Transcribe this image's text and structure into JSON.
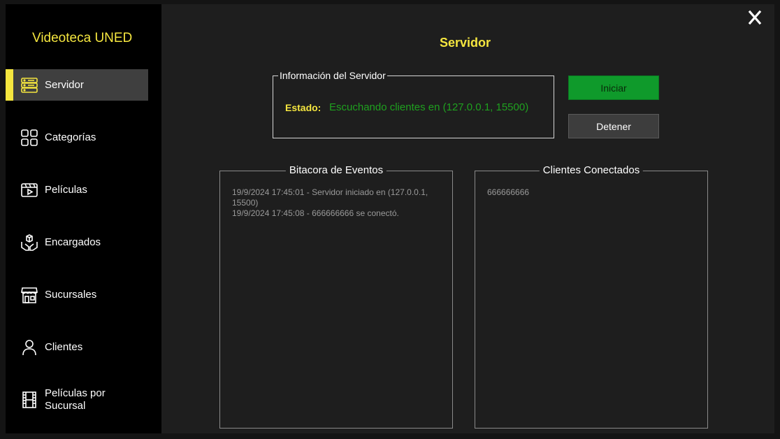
{
  "app": {
    "title": "Videoteca UNED"
  },
  "sidebar": {
    "items": [
      {
        "label": "Servidor",
        "icon": "server-icon",
        "active": true
      },
      {
        "label": "Categorías",
        "icon": "grid-icon",
        "active": false
      },
      {
        "label": "Películas",
        "icon": "video-icon",
        "active": false
      },
      {
        "label": "Encargados",
        "icon": "hands-box-icon",
        "active": false
      },
      {
        "label": "Sucursales",
        "icon": "store-icon",
        "active": false
      },
      {
        "label": "Clientes",
        "icon": "user-icon",
        "active": false
      },
      {
        "label": "Películas por Sucursal",
        "icon": "film-strip-icon",
        "active": false
      }
    ]
  },
  "window": {
    "close_label": "X"
  },
  "main": {
    "title": "Servidor",
    "info": {
      "legend": "Información del Servidor",
      "estado_label": "Estado:",
      "estado_value": "Escuchando clientes en (127.0.0.1, 15500)"
    },
    "buttons": {
      "start": "Iniciar",
      "stop": "Detener"
    },
    "log": {
      "title": "Bitacora de Eventos",
      "entries": [
        "19/9/2024 17:45:01 - Servidor iniciado en (127.0.0.1, 15500)",
        "19/9/2024 17:45:08 - 666666666 se conectó."
      ]
    },
    "clients": {
      "title": "Clientes Conectados",
      "entries": [
        "666666666"
      ]
    }
  },
  "colors": {
    "accent": "#f5e63f",
    "status_green": "#1fa01f",
    "start_button": "#0f9a2b"
  }
}
